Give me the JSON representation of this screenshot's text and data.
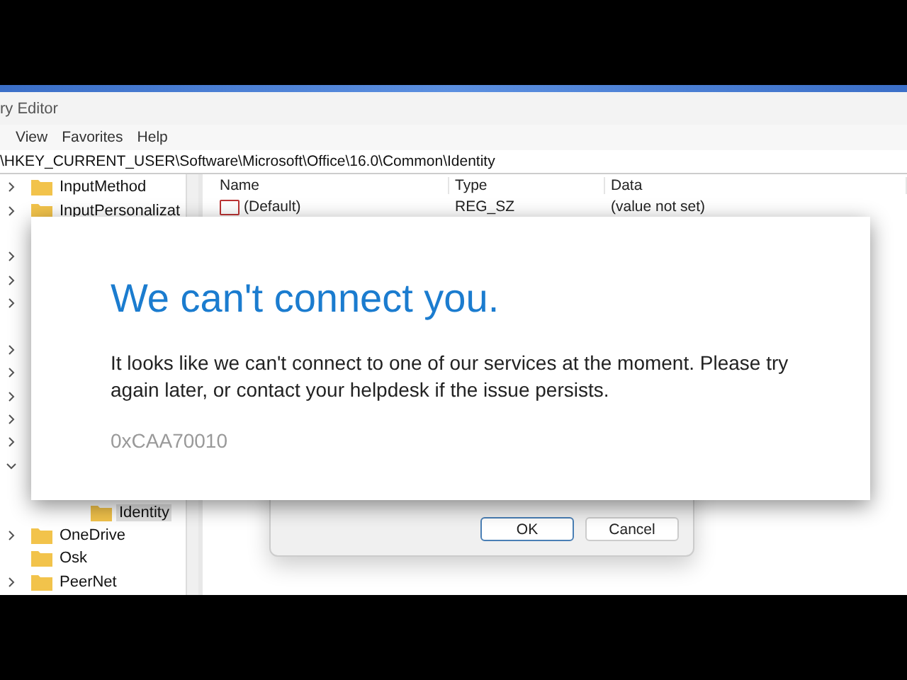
{
  "window": {
    "title": "ry Editor"
  },
  "menu": [
    "View",
    "Favorites",
    "Help"
  ],
  "address": "\\HKEY_CURRENT_USER\\Software\\Microsoft\\Office\\16.0\\Common\\Identity",
  "tree": [
    {
      "label": "InputMethod",
      "kind": "branch",
      "expanded": false,
      "selected": false
    },
    {
      "label": "InputPersonalizat",
      "kind": "branch",
      "expanded": false,
      "selected": false
    },
    {
      "kind": "covered"
    },
    {
      "kind": "branch",
      "expanded": false
    },
    {
      "kind": "branch",
      "expanded": false
    },
    {
      "kind": "branch",
      "expanded": false
    },
    {
      "kind": "covered"
    },
    {
      "kind": "branch",
      "expanded": false
    },
    {
      "kind": "branch",
      "expanded": false
    },
    {
      "kind": "branch",
      "expanded": false
    },
    {
      "kind": "branch",
      "expanded": false
    },
    {
      "kind": "branch",
      "expanded": false
    },
    {
      "kind": "branch",
      "expanded": true,
      "children": [
        {
          "children": [
            {
              "label": "Identity",
              "selected": true
            }
          ]
        }
      ]
    },
    {
      "label": "OneDrive",
      "kind": "branch",
      "expanded": false,
      "selected": false
    },
    {
      "label": "Osk",
      "kind": "leaf",
      "selected": false
    },
    {
      "label": "PeerNet",
      "kind": "branch",
      "expanded": false,
      "selected": false
    }
  ],
  "table": {
    "columns": [
      "Name",
      "Type",
      "Data"
    ],
    "rows": [
      [
        "(Default)",
        "REG_SZ",
        "(value not set)"
      ]
    ]
  },
  "back_dialog": {
    "buttons": [
      {
        "label": "OK",
        "default": true
      },
      {
        "label": "Cancel",
        "default": false
      }
    ]
  },
  "error_dialog": {
    "title": "We can't connect you.",
    "message": "It looks like we can't connect to one of our services at the moment. Please try again later, or contact your helpdesk if the issue persists.",
    "code": "0xCAA70010"
  }
}
